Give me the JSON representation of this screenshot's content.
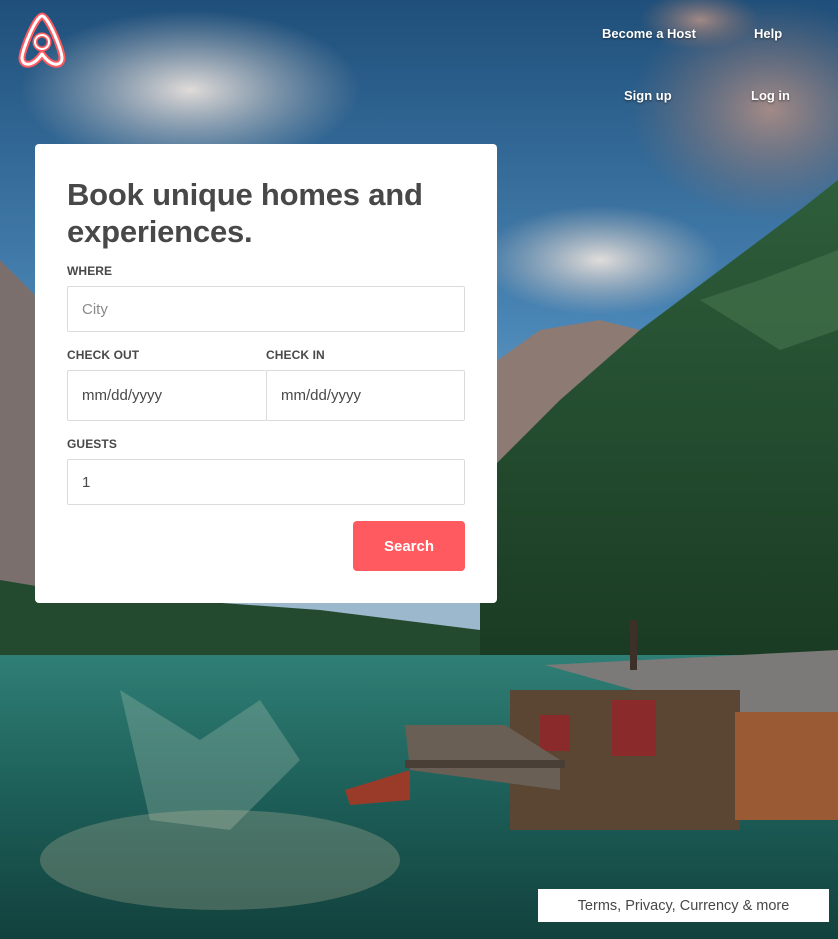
{
  "nav": {
    "become_host": "Become a Host",
    "help": "Help",
    "sign_up": "Sign up",
    "log_in": "Log in"
  },
  "search_card": {
    "title": "Book unique homes and experiences.",
    "where_label": "WHERE",
    "where_placeholder": "City",
    "checkout_label": "CHECK OUT",
    "checkout_value": "mm/dd/yyyy",
    "checkin_label": "CHECK IN",
    "checkin_value": "mm/dd/yyyy",
    "guests_label": "GUESTS",
    "guests_value": "1",
    "search_button": "Search"
  },
  "footer": {
    "link": "Terms, Privacy, Currency & more"
  },
  "icons": {
    "logo": "airbnb-logo-icon"
  },
  "colors": {
    "accent": "#ff5a5f",
    "text": "#484848"
  }
}
